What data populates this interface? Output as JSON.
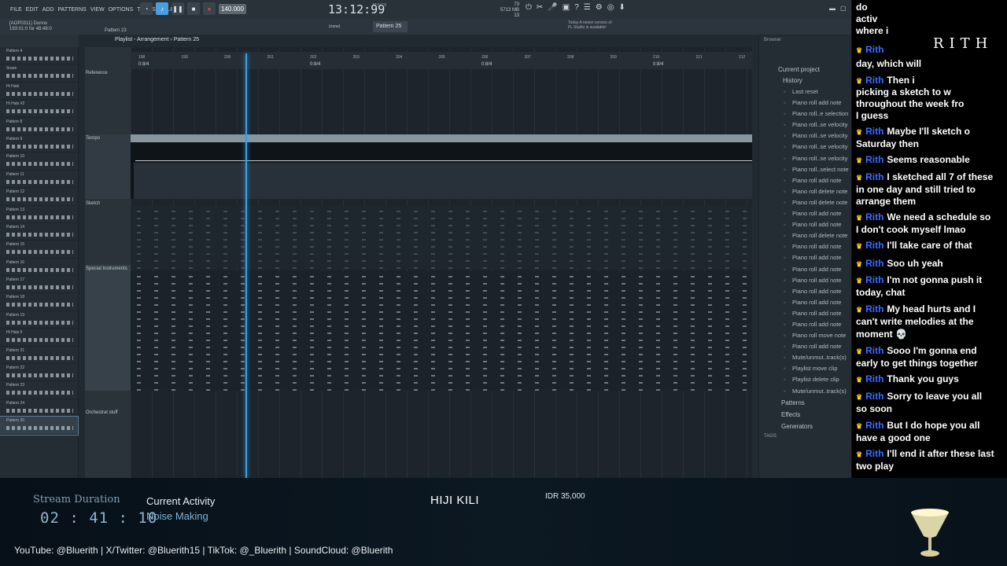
{
  "menu": [
    "FILE",
    "EDIT",
    "ADD",
    "PATTERNS",
    "VIEW",
    "OPTIONS",
    "TOOLS",
    "HELP"
  ],
  "transport": {
    "tempo": "140.000",
    "clock": "13:12:99",
    "clock_sub": "M:S:CS",
    "memory": "5713 MB",
    "cpu": "73",
    "voices": "13"
  },
  "hint": {
    "line1": "[AOP0311] Dunno",
    "line2": "193:01:0 for 48:48:0"
  },
  "pattern_label": "Pattern 23",
  "pattern_selector": "Pattern 25",
  "none_label": "(none)",
  "news": {
    "line1": "Today  A newer version of",
    "line2": "FL Studio is available!"
  },
  "playlist_title": "Playlist - Arrangement  ›  Pattern 25",
  "ruler": {
    "bars": [
      "198",
      "199",
      "200",
      "201",
      "202",
      "203",
      "204",
      "205",
      "206",
      "207",
      "208",
      "209",
      "210",
      "211",
      "212"
    ],
    "sections": [
      "0:8/4",
      "0:8/4",
      "0:8/4",
      "0:8/4"
    ]
  },
  "patterns": [
    "Pattern 4",
    "Snare",
    "Hi Hats",
    "Hi Hats #2",
    "Pattern 8",
    "Pattern 9",
    "Pattern 10",
    "Pattern 11",
    "Pattern 12",
    "Pattern 13",
    "Pattern 14",
    "Pattern 15",
    "Pattern 16",
    "Pattern 17",
    "Pattern 18",
    "Pattern 19",
    "Hi Hats II",
    "Pattern 21",
    "Pattern 22",
    "Pattern 23",
    "Pattern 24",
    "Pattern 25"
  ],
  "tracks": {
    "reference": "Reference",
    "tempo": "Tempo",
    "sketch": "Sketch",
    "special": "Special Instruments",
    "orchestral": "Orchestral stuff"
  },
  "browser": {
    "title": "Browser",
    "current": "Current project",
    "history": "History",
    "items": [
      "Last reset",
      "Piano roll add note",
      "Piano roll..e selection",
      "Piano roll..se velocity",
      "Piano roll..se velocity",
      "Piano roll..se velocity",
      "Piano roll..se velocity",
      "Piano roll..select note",
      "Piano roll add note",
      "Piano roll delete note",
      "Piano roll delete note",
      "Piano roll add note",
      "Piano roll add note",
      "Piano roll delete note",
      "Piano roll add note",
      "Piano roll add note",
      "Piano roll add note",
      "Piano roll add note",
      "Piano roll add note",
      "Piano roll add note",
      "Piano roll add note",
      "Piano roll add note",
      "Piano roll move note",
      "Piano roll add note",
      "Mute/unmut..track(s)",
      "Playlist move clip",
      "Playlist delete clip",
      "Mute/unmut..track(s)"
    ],
    "footer": [
      "Patterns",
      "Effects",
      "Generators"
    ],
    "tags": "TAGS"
  },
  "chat": {
    "brand": "RITH",
    "messages": [
      {
        "user": "",
        "text": "do"
      },
      {
        "user": "",
        "text": "activ"
      },
      {
        "user": "",
        "text": "where i"
      },
      {
        "user": "Rith",
        "text": ""
      },
      {
        "user": "",
        "text": "day, which will"
      },
      {
        "user": "Rith",
        "text": "Then i"
      },
      {
        "user": "",
        "text": "picking a sketch to w"
      },
      {
        "user": "",
        "text": "throughout the week fro"
      },
      {
        "user": "",
        "text": "I guess"
      },
      {
        "user": "Rith",
        "text": "Maybe I'll sketch o"
      },
      {
        "user": "",
        "text": "Saturday then"
      },
      {
        "user": "Rith",
        "text": "Seems reasonable"
      },
      {
        "user": "Rith",
        "text": "I sketched all 7 of these"
      },
      {
        "user": "",
        "text": "in one day and still tried to"
      },
      {
        "user": "",
        "text": "arrange them"
      },
      {
        "user": "Rith",
        "text": "We need a schedule so"
      },
      {
        "user": "",
        "text": "I don't cook myself lmao"
      },
      {
        "user": "Rith",
        "text": "I'll take care of that"
      },
      {
        "user": "Rith",
        "text": "Soo uh yeah"
      },
      {
        "user": "Rith",
        "text": "I'm not gonna push it"
      },
      {
        "user": "",
        "text": "today, chat"
      },
      {
        "user": "Rith",
        "text": "My head hurts and I"
      },
      {
        "user": "",
        "text": "can't write melodies at the"
      },
      {
        "user": "",
        "text": "moment 💀"
      },
      {
        "user": "Rith",
        "text": "Sooo I'm gonna end"
      },
      {
        "user": "",
        "text": "early to get things together"
      },
      {
        "user": "Rith",
        "text": "Thank you guys"
      },
      {
        "user": "Rith",
        "text": "Sorry to leave you all"
      },
      {
        "user": "",
        "text": "so soon"
      },
      {
        "user": "Rith",
        "text": "But I do hope you all"
      },
      {
        "user": "",
        "text": "have a good one"
      },
      {
        "user": "Rith",
        "text": "I'll end it after these last"
      },
      {
        "user": "",
        "text": "two play"
      }
    ]
  },
  "overlay": {
    "duration_label": "Stream Duration",
    "duration_value": "02 : 41 : 10",
    "activity_label": "Current Activity",
    "activity_value": "Noise Making",
    "song": "HIJI KILI",
    "price": "IDR 35,000",
    "socials": "YouTube: @Bluerith |  X/Twitter: @Bluerith15  |  TikTok: @_Bluerith  |  SoundCloud: @Bluerith"
  },
  "colors": {
    "accent": "#3aa0e8",
    "panel": "#222a31",
    "chat_user": "#3b6cff",
    "crown": "#ffd400"
  }
}
